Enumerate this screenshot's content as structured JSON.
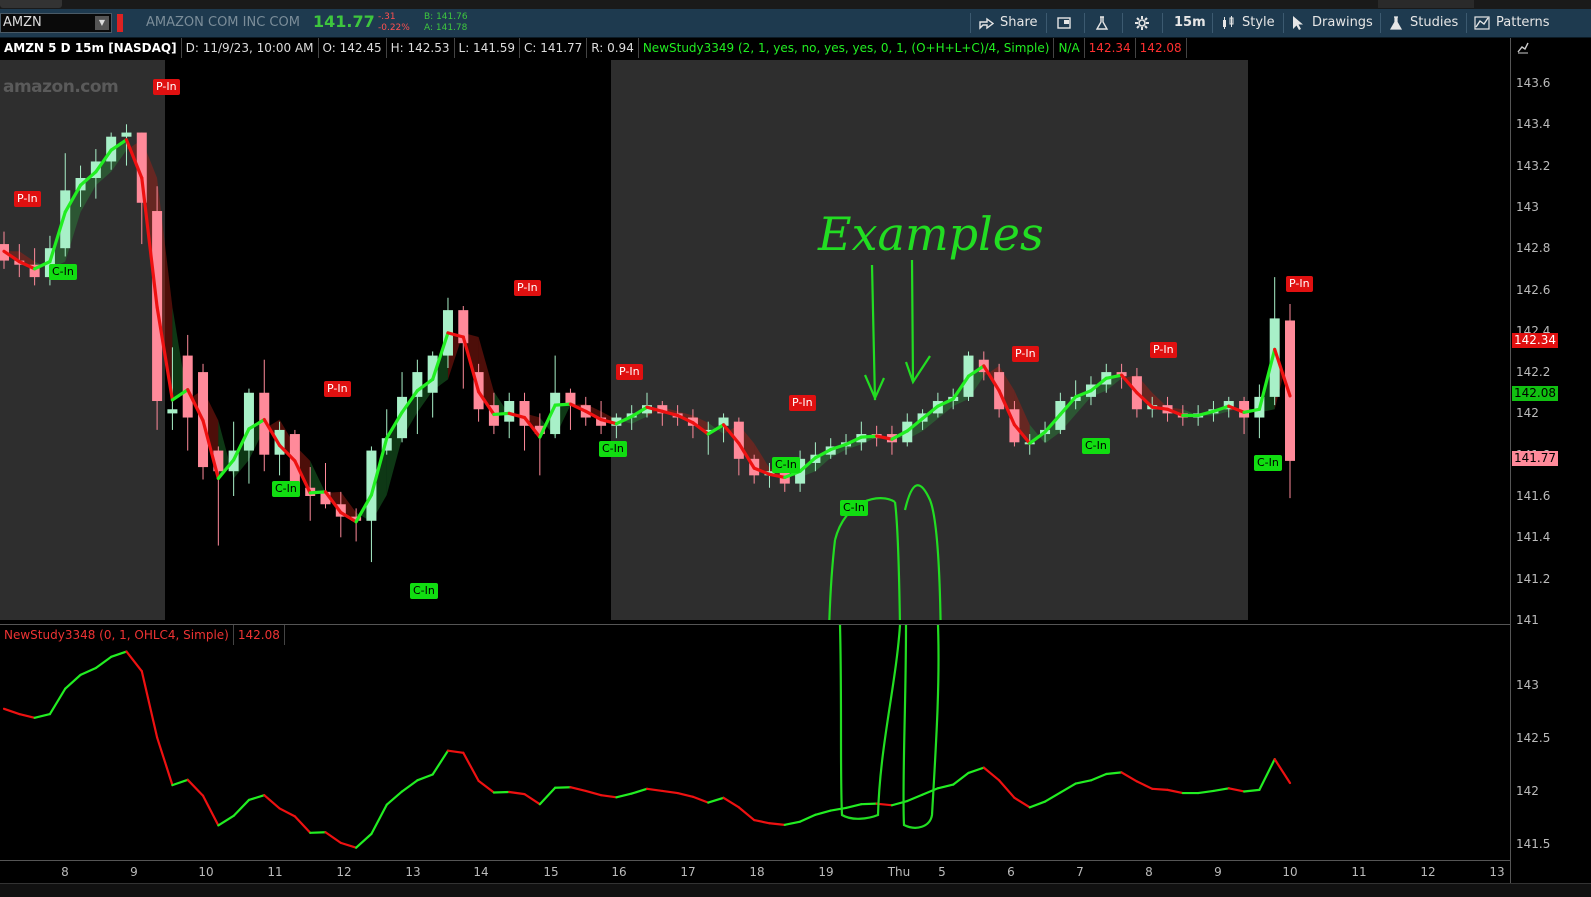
{
  "toolbar": {
    "symbol": "AMZN",
    "company": "AMAZON COM INC COM",
    "last": "141.77",
    "change": "-.31",
    "change_pct": "-0.22%",
    "bid": "B: 141.76",
    "ask": "A: 141.78",
    "buttons": {
      "share": "Share",
      "interval": "15m",
      "style": "Style",
      "drawings": "Drawings",
      "studies": "Studies",
      "patterns": "Patterns"
    },
    "icons": [
      "share-icon",
      "detach-icon",
      "flask-icon",
      "gear-icon",
      "style-icon",
      "cursor-icon",
      "studies-icon",
      "patterns-icon"
    ]
  },
  "info": {
    "title": "AMZN 5 D 15m [NASDAQ]",
    "date": "D: 11/9/23, 10:00 AM",
    "open": "O: 142.45",
    "high": "H: 142.53",
    "low": "L: 141.59",
    "close": "C: 141.77",
    "range": "R: 0.94",
    "study": "NewStudy3349 (2, 1, yes, no, yes, yes, 0, 1, (O+H+L+C)/4, Simple)",
    "na": "N/A",
    "v1": "142.34",
    "v2": "142.08"
  },
  "watermark": "amazon.com",
  "price_axis": {
    "ticks": [
      "143.6",
      "143.4",
      "143.2",
      "143",
      "142.8",
      "142.6",
      "142.4",
      "142.2",
      "142",
      "141.8",
      "141.6",
      "141.4",
      "141.2",
      "141"
    ],
    "markers": [
      {
        "value": "142.34",
        "bg": "#e01010",
        "fg": "#ffffff"
      },
      {
        "value": "142.08",
        "bg": "#11c011",
        "fg": "#000000"
      },
      {
        "value": "141.77",
        "bg": "#ff8a9a",
        "fg": "#000000"
      }
    ]
  },
  "lower": {
    "study": "NewStudy3348 (0, 1, OHLC4, Simple)",
    "value": "142.08",
    "ticks": [
      "143",
      "142.5",
      "142",
      "141.5"
    ]
  },
  "time_axis": [
    "8",
    "9",
    "10",
    "11",
    "12",
    "13",
    "14",
    "15",
    "16",
    "17",
    "18",
    "19",
    "Thu",
    "5",
    "6",
    "7",
    "8",
    "9",
    "10",
    "11",
    "12",
    "13"
  ],
  "labels": {
    "pin": "P-In",
    "cin": "C-In"
  },
  "annotation": {
    "text": "Examples",
    "color": "#22dd22"
  },
  "colors": {
    "up": "#a8f0c8",
    "down": "#ff8a9a",
    "line_up": "#22ee22",
    "line_down": "#ee1111",
    "session_bg": "#2e2e2e"
  }
}
